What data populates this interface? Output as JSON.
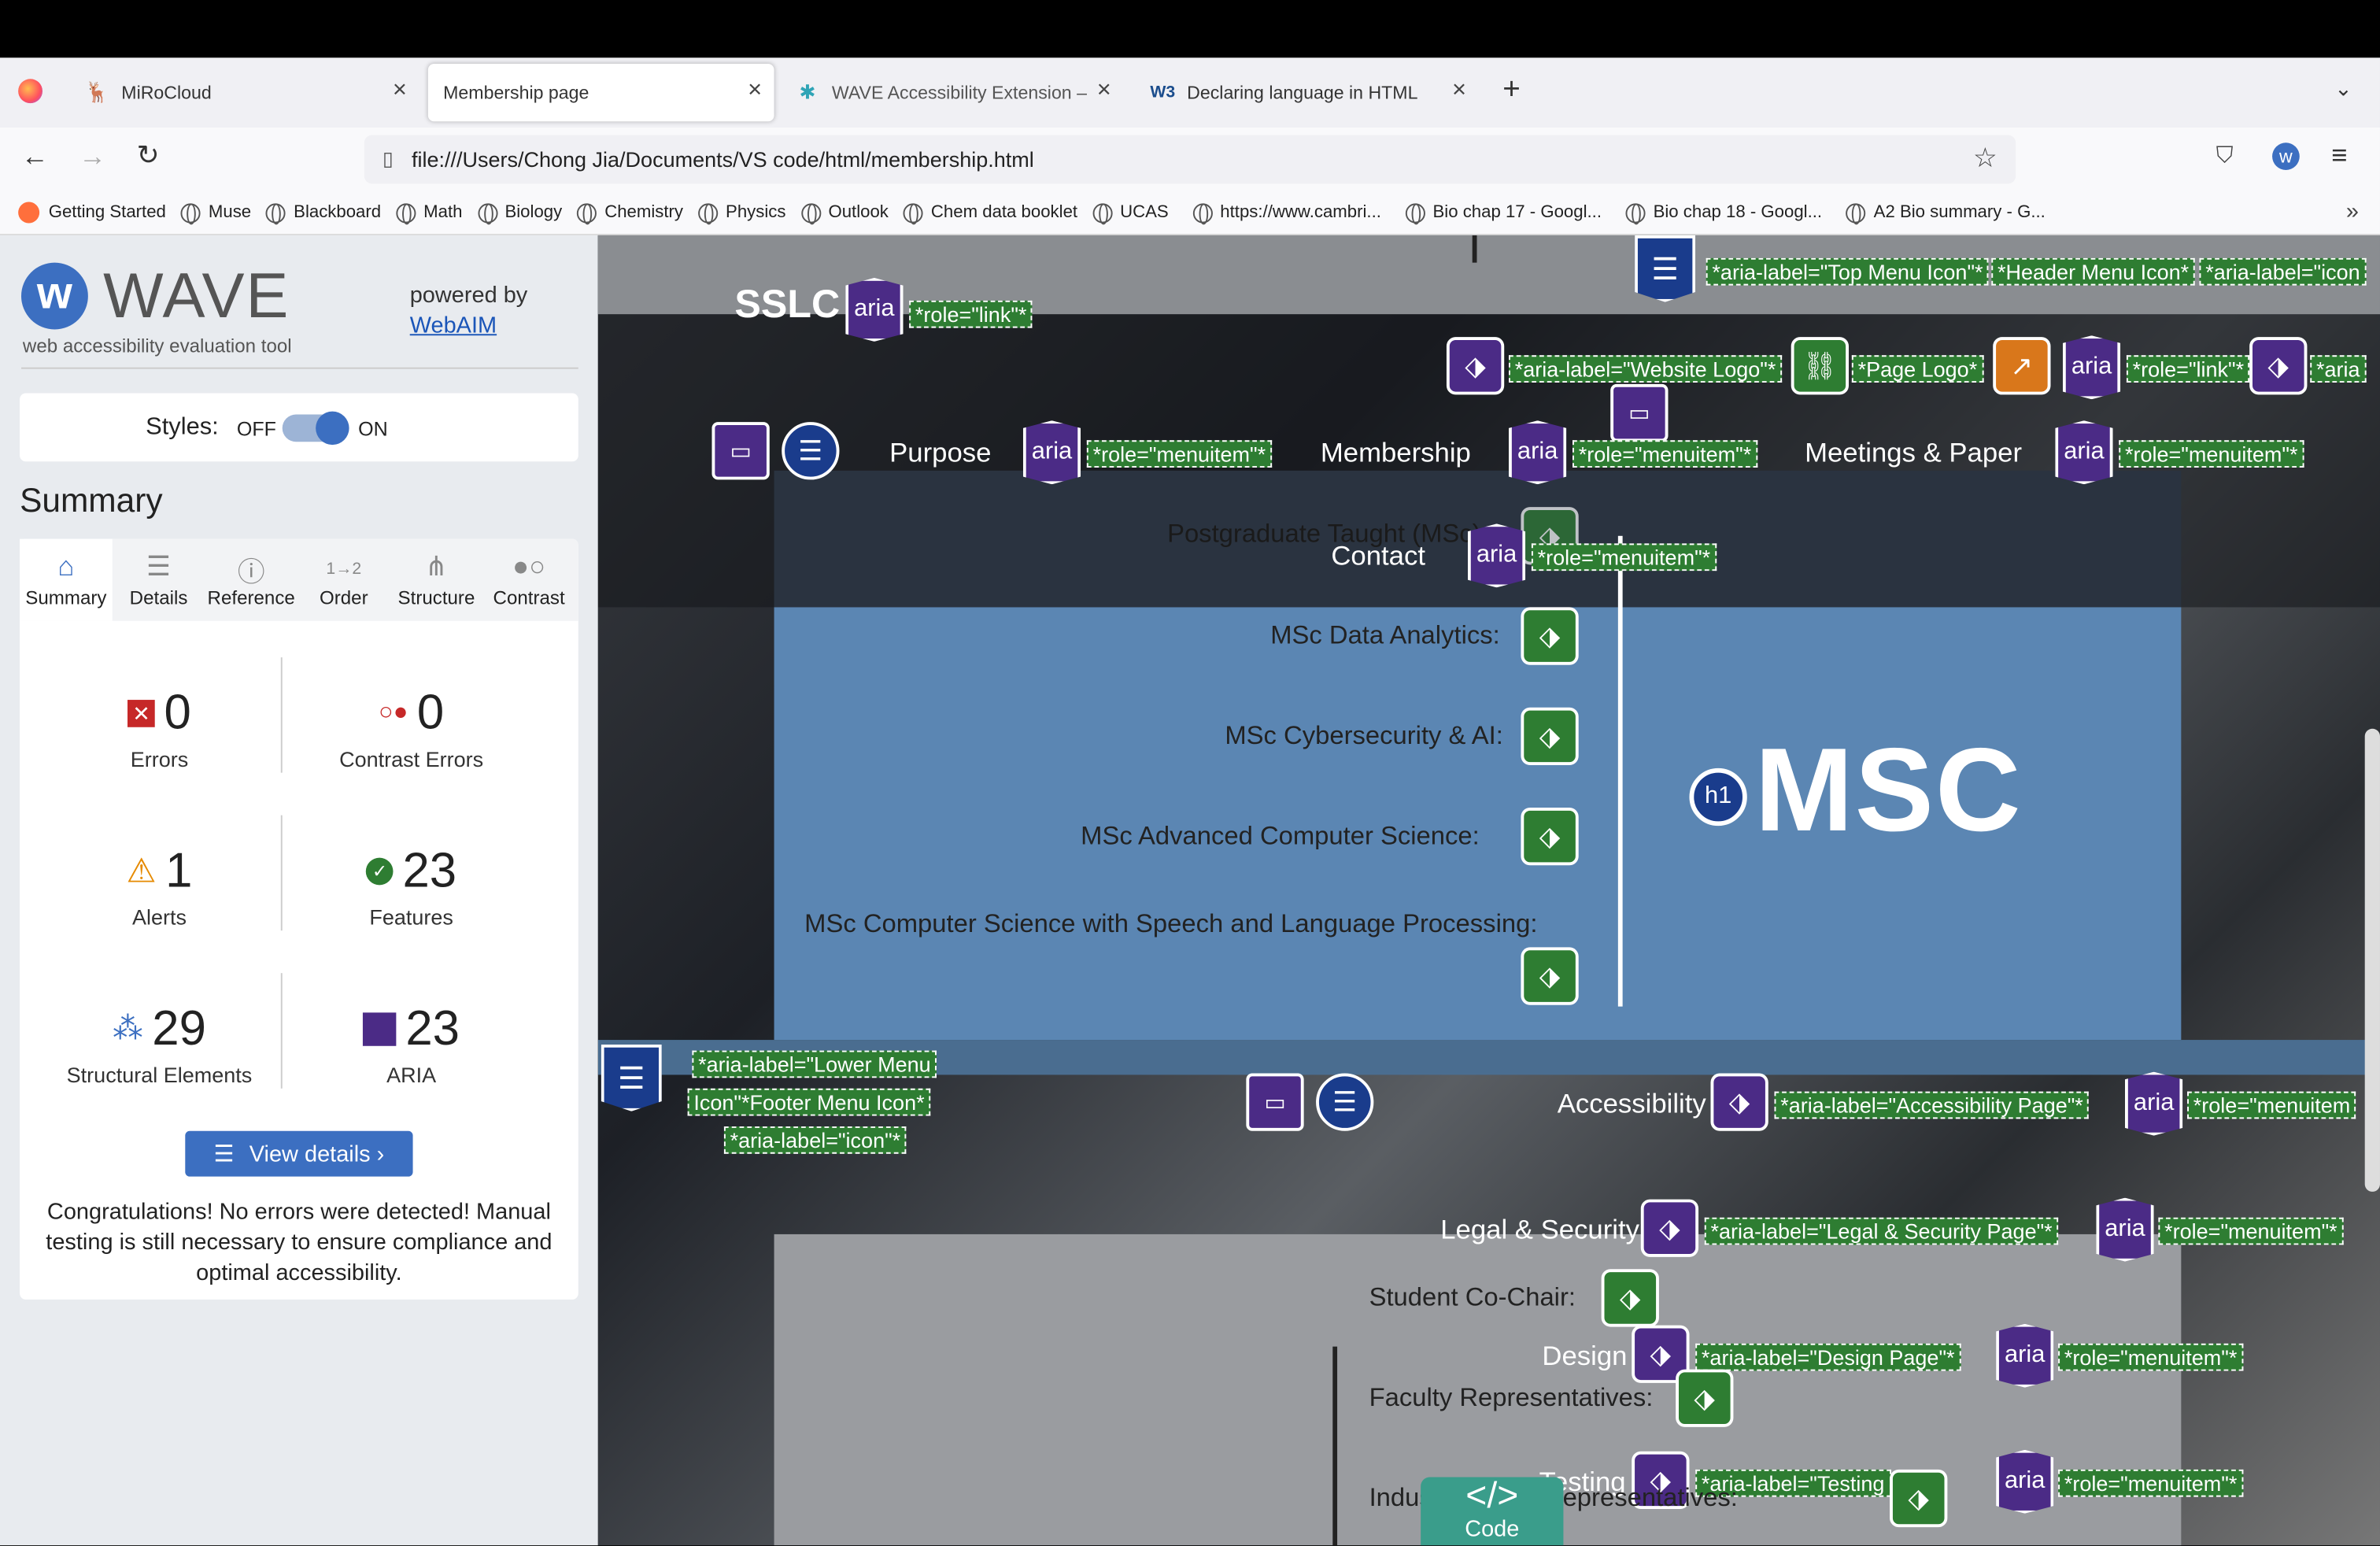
{
  "browser": {
    "tabs": [
      {
        "title": "MiRoCloud",
        "icon": "mirocloud-icon"
      },
      {
        "title": "Membership page",
        "icon": "",
        "active": true
      },
      {
        "title": "WAVE Accessibility Extension –",
        "icon": "wave-puzzle-icon"
      },
      {
        "title": "Declaring language in HTML",
        "icon": "w3-icon"
      }
    ],
    "url": "file:///Users/Chong Jia/Documents/VS code/html/membership.html",
    "bookmarks": [
      "Getting Started",
      "Muse",
      "Blackboard",
      "Math",
      "Biology",
      "Chemistry",
      "Physics",
      "Outlook",
      "Chem data booklet",
      "UCAS",
      "https://www.cambri...",
      "Bio chap 17 - Googl...",
      "Bio chap 18 - Googl...",
      "A2 Bio summary - G..."
    ]
  },
  "wave": {
    "logo_text": "WAVE",
    "tagline": "web accessibility evaluation tool",
    "powered_by": "powered by",
    "webaim": "WebAIM",
    "styles_label": "Styles:",
    "styles_off": "OFF",
    "styles_on": "ON",
    "summary_title": "Summary",
    "tabs": [
      "Summary",
      "Details",
      "Reference",
      "Order",
      "Structure",
      "Contrast"
    ],
    "stats": [
      {
        "value": "0",
        "label": "Errors"
      },
      {
        "value": "0",
        "label": "Contrast Errors"
      },
      {
        "value": "1",
        "label": "Alerts"
      },
      {
        "value": "23",
        "label": "Features"
      },
      {
        "value": "29",
        "label": "Structural Elements"
      },
      {
        "value": "23",
        "label": "ARIA"
      }
    ],
    "view_details": "View details ›",
    "message": "Congratulations! No errors were detected! Manual testing is still necessary to ensure compliance and optimal accessibility."
  },
  "page": {
    "brand": "SSLC",
    "aria_text": "aria",
    "h1_badge": "h1",
    "nav": [
      "Purpose",
      "Membership",
      "Meetings & Paper",
      "Contact"
    ],
    "heading": "MSC",
    "programs": [
      "Postgraduate Taught (MSc)",
      "MSc Data Analytics:",
      "MSc Cybersecurity & AI:",
      "MSc Advanced Computer Science:",
      "MSc Computer Science with Speech and Language Processing:"
    ],
    "footer_nav": [
      "Accessibility",
      "Legal & Security",
      "Design",
      "Testing"
    ],
    "roles": [
      "Student Co-Chair:",
      "Faculty Representatives:",
      "Industry Board Representatives:"
    ],
    "attrs": {
      "top_menu": "*aria-label=\"Top Menu Icon\"*",
      "header_menu": "*Header Menu Icon*",
      "icon_cut": "*aria-label=\"icon",
      "role_link": "*role=\"link\"*",
      "website_logo": "*aria-label=\"Website Logo\"*",
      "page_logo": "*Page Logo*",
      "aria_cut": "*aria",
      "role_menuitem": "*role=\"menuitem\"*",
      "lower_menu_1": "*aria-label=\"Lower Menu",
      "lower_menu_2": "Icon\"*Footer Menu Icon*",
      "lower_menu_3": "*aria-label=\"icon\"*",
      "accessibility_page": "*aria-label=\"Accessibility Page\"*",
      "role_menuitem_cut": "*role=\"menuitem",
      "legal_page": "*aria-label=\"Legal & Security Page\"*",
      "design_page": "*aria-label=\"Design Page\"*",
      "testing_page": "*aria-label=\"Testing"
    },
    "code_button": "Code",
    "code_glyph": "</>"
  },
  "colors": {
    "wave_blue": "#3c6fc1",
    "aria_purple": "#4b2b86",
    "feature_green": "#2e7d32",
    "panel_blue": "#5b86b3"
  }
}
